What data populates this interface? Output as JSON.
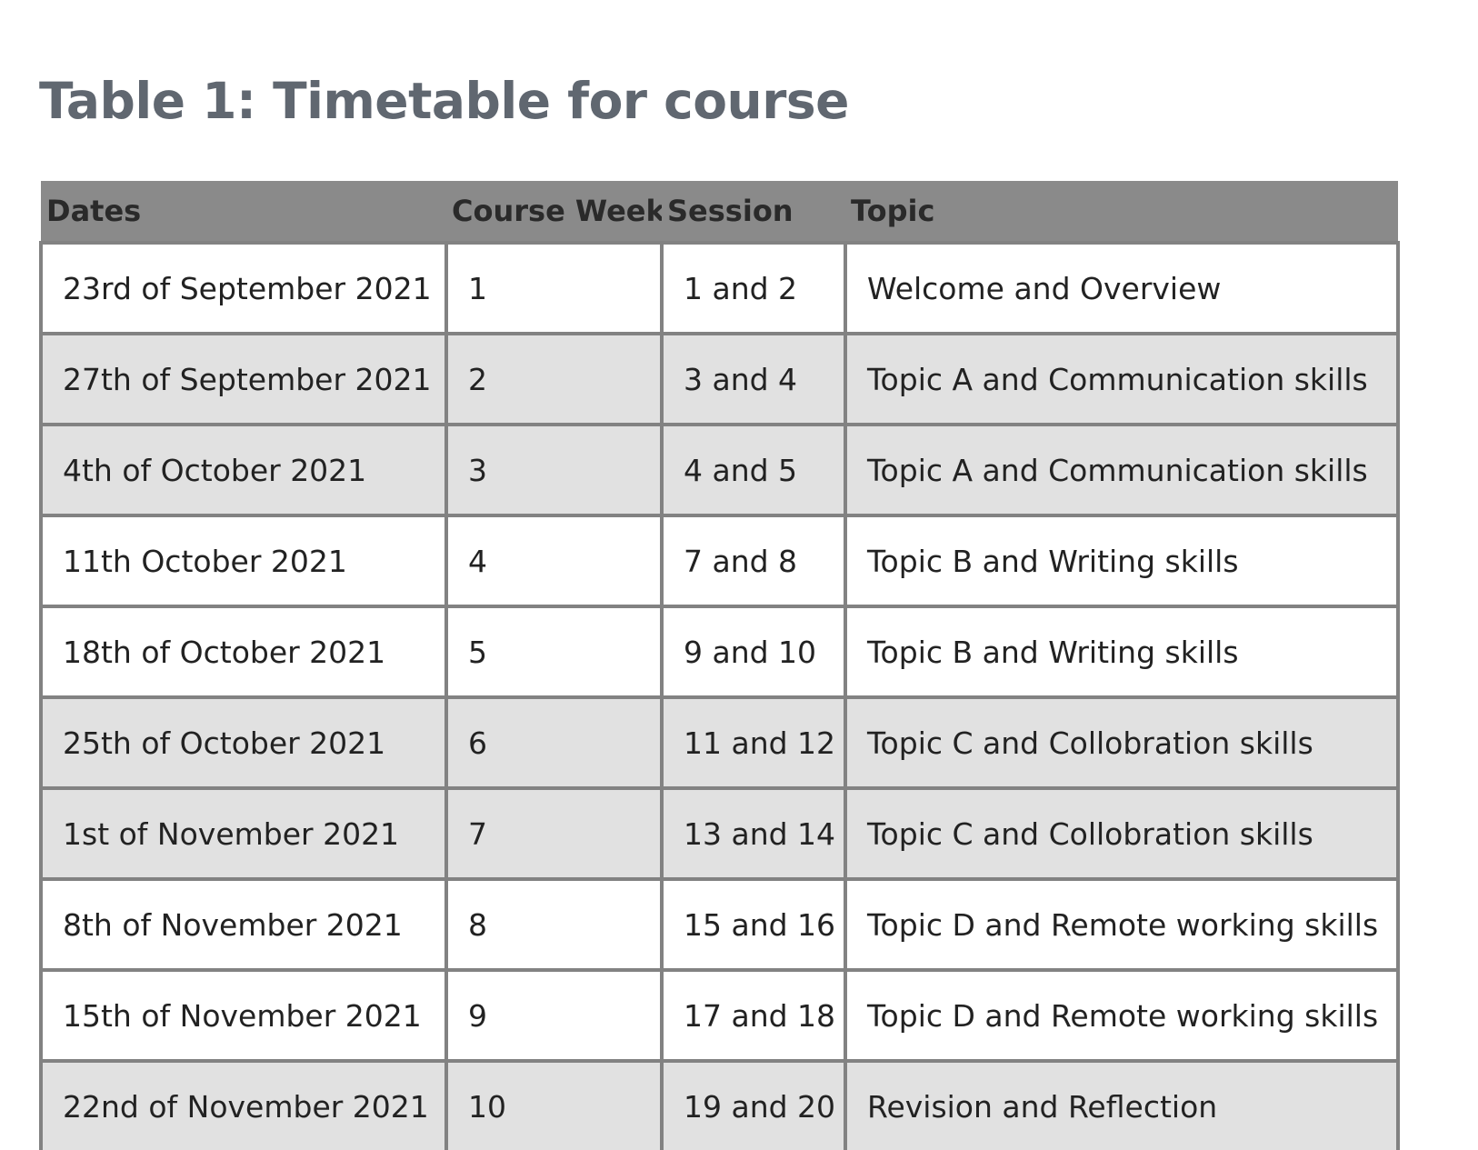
{
  "title": "Table 1: Timetable for course",
  "table": {
    "headers": {
      "dates": "Dates",
      "course_week": "Course Week",
      "session": "Session",
      "topic": "Topic"
    },
    "rows": [
      {
        "dates": "23rd of September 2021",
        "course_week": "1",
        "session": "1 and 2",
        "topic": "Welcome and Overview"
      },
      {
        "dates": "27th of September 2021",
        "course_week": "2",
        "session": "3 and 4",
        "topic": "Topic A and Communication skills"
      },
      {
        "dates": "4th of October 2021",
        "course_week": "3",
        "session": "4 and 5",
        "topic": "Topic A and Communication skills"
      },
      {
        "dates": "11th October 2021",
        "course_week": "4",
        "session": "7 and 8",
        "topic": "Topic B and Writing skills"
      },
      {
        "dates": "18th of October 2021",
        "course_week": "5",
        "session": "9 and 10",
        "topic": "Topic B and Writing skills"
      },
      {
        "dates": "25th of October 2021",
        "course_week": "6",
        "session": "11 and 12",
        "topic": "Topic C and Collobration skills"
      },
      {
        "dates": "1st of November 2021",
        "course_week": "7",
        "session": "13 and 14",
        "topic": "Topic C and Collobration skills"
      },
      {
        "dates": "8th of November 2021",
        "course_week": "8",
        "session": "15 and 16",
        "topic": "Topic D and Remote working skills"
      },
      {
        "dates": "15th of November 2021",
        "course_week": "9",
        "session": "17 and 18",
        "topic": "Topic D and Remote working skills"
      },
      {
        "dates": "22nd of November 2021",
        "course_week": "10",
        "session": "19 and 20",
        "topic": "Revision and Reflection"
      }
    ]
  },
  "colors": {
    "title": "#606770",
    "header_background": "#8a8a8a",
    "row_stripe": "#e1e1e1",
    "row_plain": "#ffffff",
    "cell_border": "#828282"
  }
}
